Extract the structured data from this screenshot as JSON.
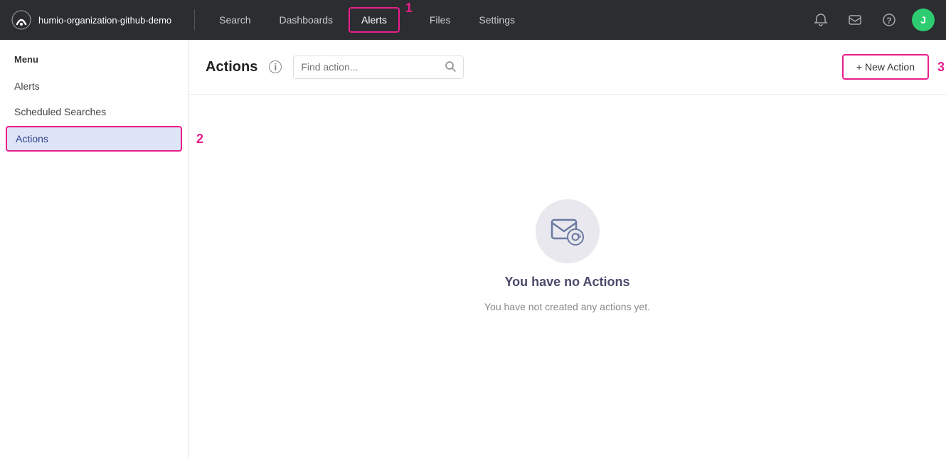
{
  "topnav": {
    "org_name": "humio-organization-github-demo",
    "links": [
      {
        "label": "Search",
        "active": false
      },
      {
        "label": "Dashboards",
        "active": false
      },
      {
        "label": "Alerts",
        "active": true
      },
      {
        "label": "Files",
        "active": false
      },
      {
        "label": "Settings",
        "active": false
      }
    ],
    "avatar_initial": "J"
  },
  "sidebar": {
    "menu_label": "Menu",
    "items": [
      {
        "label": "Alerts",
        "active": false
      },
      {
        "label": "Scheduled Searches",
        "active": false
      },
      {
        "label": "Actions",
        "active": true
      }
    ]
  },
  "main": {
    "title": "Actions",
    "search_placeholder": "Find action...",
    "new_action_label": "+ New Action",
    "empty_state": {
      "title": "You have no Actions",
      "subtitle": "You have not created any actions yet."
    }
  },
  "annotations": {
    "nav_badge": "1",
    "sidebar_badge": "2",
    "button_badge": "3"
  }
}
